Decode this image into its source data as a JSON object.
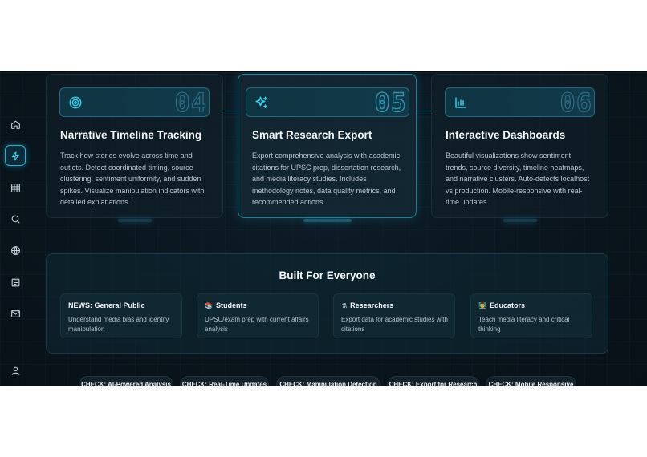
{
  "sidebar": {
    "items": [
      {
        "icon": "home-icon"
      },
      {
        "icon": "bolt-icon",
        "active": true
      },
      {
        "icon": "grid-icon"
      },
      {
        "icon": "search-icon"
      },
      {
        "icon": "globe-icon"
      },
      {
        "icon": "newspaper-icon"
      },
      {
        "icon": "mail-icon"
      },
      {
        "icon": "user-icon"
      }
    ]
  },
  "features": [
    {
      "icon": "target-icon",
      "number": "04",
      "title": "Narrative Timeline Tracking",
      "description": "Track how stories evolve across time and outlets. Detect coordinated timing, source clustering, sentiment uniformity, and sudden spikes. Visualize manipulation indicators with detailed explanations."
    },
    {
      "icon": "sparkles-icon",
      "number": "05",
      "title": "Smart Research Export",
      "description": "Export comprehensive analysis with academic citations for UPSC prep, dissertation research, and media literacy studies. Includes methodology notes, data quality metrics, and recommended actions.",
      "featured": true
    },
    {
      "icon": "bar-chart-icon",
      "number": "06",
      "title": "Interactive Dashboards",
      "description": "Beautiful visualizations show sentiment trends, source diversity, timeline heatmaps, and narrative clusters. Auto-detects localhost vs production. Mobile-responsive with real-time updates."
    }
  ],
  "everyone": {
    "heading": "Built For Everyone",
    "audiences": [
      {
        "emoji": "",
        "title": "NEWS: General Public",
        "text": "Understand media bias and identify manipulation"
      },
      {
        "emoji": "📚",
        "title": "Students",
        "text": "UPSC/exam prep with current affairs analysis"
      },
      {
        "emoji": "⚗",
        "title": "Researchers",
        "text": "Export data for academic studies with citations"
      },
      {
        "emoji": "👨‍🏫",
        "title": "Educators",
        "text": "Teach media literacy and critical thinking"
      }
    ]
  },
  "checks": [
    "CHECK: AI-Powered Analysis",
    "CHECK: Real-Time Updates",
    "CHECK: Manipulation Detection",
    "CHECK: Export for Research",
    "CHECK: Mobile Responsive"
  ],
  "colors": {
    "accent": "#2fd0ef",
    "background": "#0a151d",
    "text": "#f2f6f8"
  }
}
